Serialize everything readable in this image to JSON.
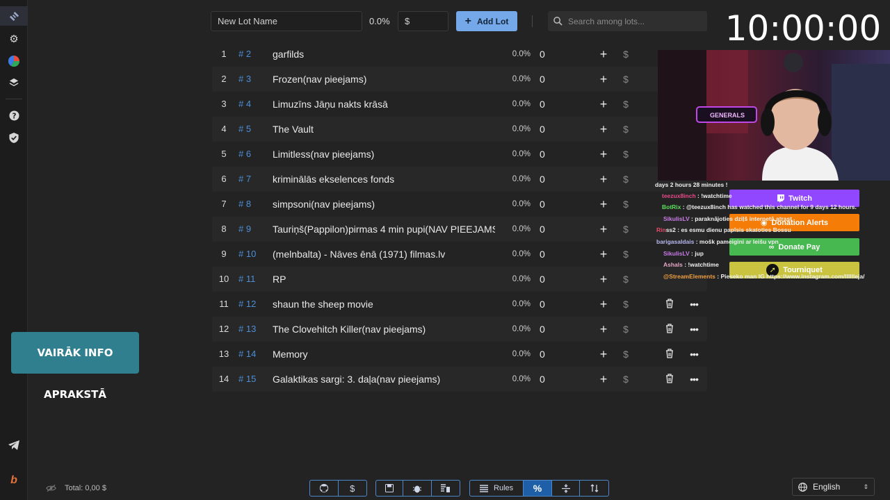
{
  "toolbar": {
    "new_lot_placeholder": "New Lot Name",
    "percent": "0.0%",
    "amount_placeholder": "$",
    "add_lot_label": "Add Lot",
    "search_placeholder": "Search among lots..."
  },
  "lots": [
    {
      "num": "1",
      "id": "# 2",
      "name": "garfilds",
      "pct": "0.0%",
      "amount": "0"
    },
    {
      "num": "2",
      "id": "# 3",
      "name": "Frozen(nav pieejams)",
      "pct": "0.0%",
      "amount": "0"
    },
    {
      "num": "3",
      "id": "# 4",
      "name": "Limuzīns Jāņu nakts krāsā",
      "pct": "0.0%",
      "amount": "0"
    },
    {
      "num": "4",
      "id": "# 5",
      "name": "The Vault",
      "pct": "0.0%",
      "amount": "0"
    },
    {
      "num": "5",
      "id": "# 6",
      "name": "Limitless(nav pieejams)",
      "pct": "0.0%",
      "amount": "0"
    },
    {
      "num": "6",
      "id": "# 7",
      "name": "kriminālās ekselences fonds",
      "pct": "0.0%",
      "amount": "0"
    },
    {
      "num": "7",
      "id": "# 8",
      "name": "simpsoni(nav pieejams)",
      "pct": "0.0%",
      "amount": "0"
    },
    {
      "num": "8",
      "id": "# 9",
      "name": "Tauriņš(Pappilon)pirmas 4 min pupi(NAV PIEEJAMS",
      "pct": "0.0%",
      "amount": "0"
    },
    {
      "num": "9",
      "id": "# 10",
      "name": "(melnbalta) - Nāves ēnā (1971) filmas.lv",
      "pct": "0.0%",
      "amount": "0"
    },
    {
      "num": "10",
      "id": "# 11",
      "name": "RP",
      "pct": "0.0%",
      "amount": "0"
    },
    {
      "num": "11",
      "id": "# 12",
      "name": "shaun the sheep movie",
      "pct": "0.0%",
      "amount": "0"
    },
    {
      "num": "12",
      "id": "# 13",
      "name": "The Clovehitch Killer(nav pieejams)",
      "pct": "0.0%",
      "amount": "0"
    },
    {
      "num": "13",
      "id": "# 14",
      "name": "Memory",
      "pct": "0.0%",
      "amount": "0"
    },
    {
      "num": "14",
      "id": "# 15",
      "name": "Galaktikas sargi: 3. daļa(nav pieejams)",
      "pct": "0.0%",
      "amount": "0"
    }
  ],
  "timer": "10:00:00",
  "webcam": {
    "sign": "GENERALS"
  },
  "chat": [
    {
      "user": "",
      "text": "days 2 hours 28 minutes !"
    },
    {
      "user": "teezux8inch",
      "text": " : !watchtime"
    },
    {
      "user": "BotRix",
      "text": " : @teezux8inch has watched this channel for 9 days 12 hours."
    },
    {
      "user": "SikulisLV",
      "text": " : paraknājoties dziļš internetā atrast"
    },
    {
      "user": "Rin",
      "text": "ss2 : es esmu dienu papīsis skatoties Bossu"
    },
    {
      "user": "barigasaldais",
      "text": " : mošk pameigini ar leišu vpn"
    },
    {
      "user": "SikulisLV",
      "text": " : jup"
    },
    {
      "user": "Ashals",
      "text": " : !watchtime"
    },
    {
      "user": "@StreamElements",
      "text": " : Pieseko man IG https://www.instagram.com/lllllleja/"
    }
  ],
  "panel_buttons": [
    "Twitch",
    "Donation Alerts",
    "Donate Pay",
    "Tourniquet"
  ],
  "banner": "VAIRĀK INFO APRAKSTĀ",
  "footer": {
    "total_label": "Total: 0,00 $",
    "rules_label": "Rules",
    "language": "English"
  },
  "colors": {
    "accent": "#74a8e8",
    "id_blue": "#4e8fd8",
    "twitch": "#9146ff",
    "donation_alerts": "#f57d07",
    "donate_pay": "#47b84f",
    "tourniquet": "#c9c340"
  }
}
